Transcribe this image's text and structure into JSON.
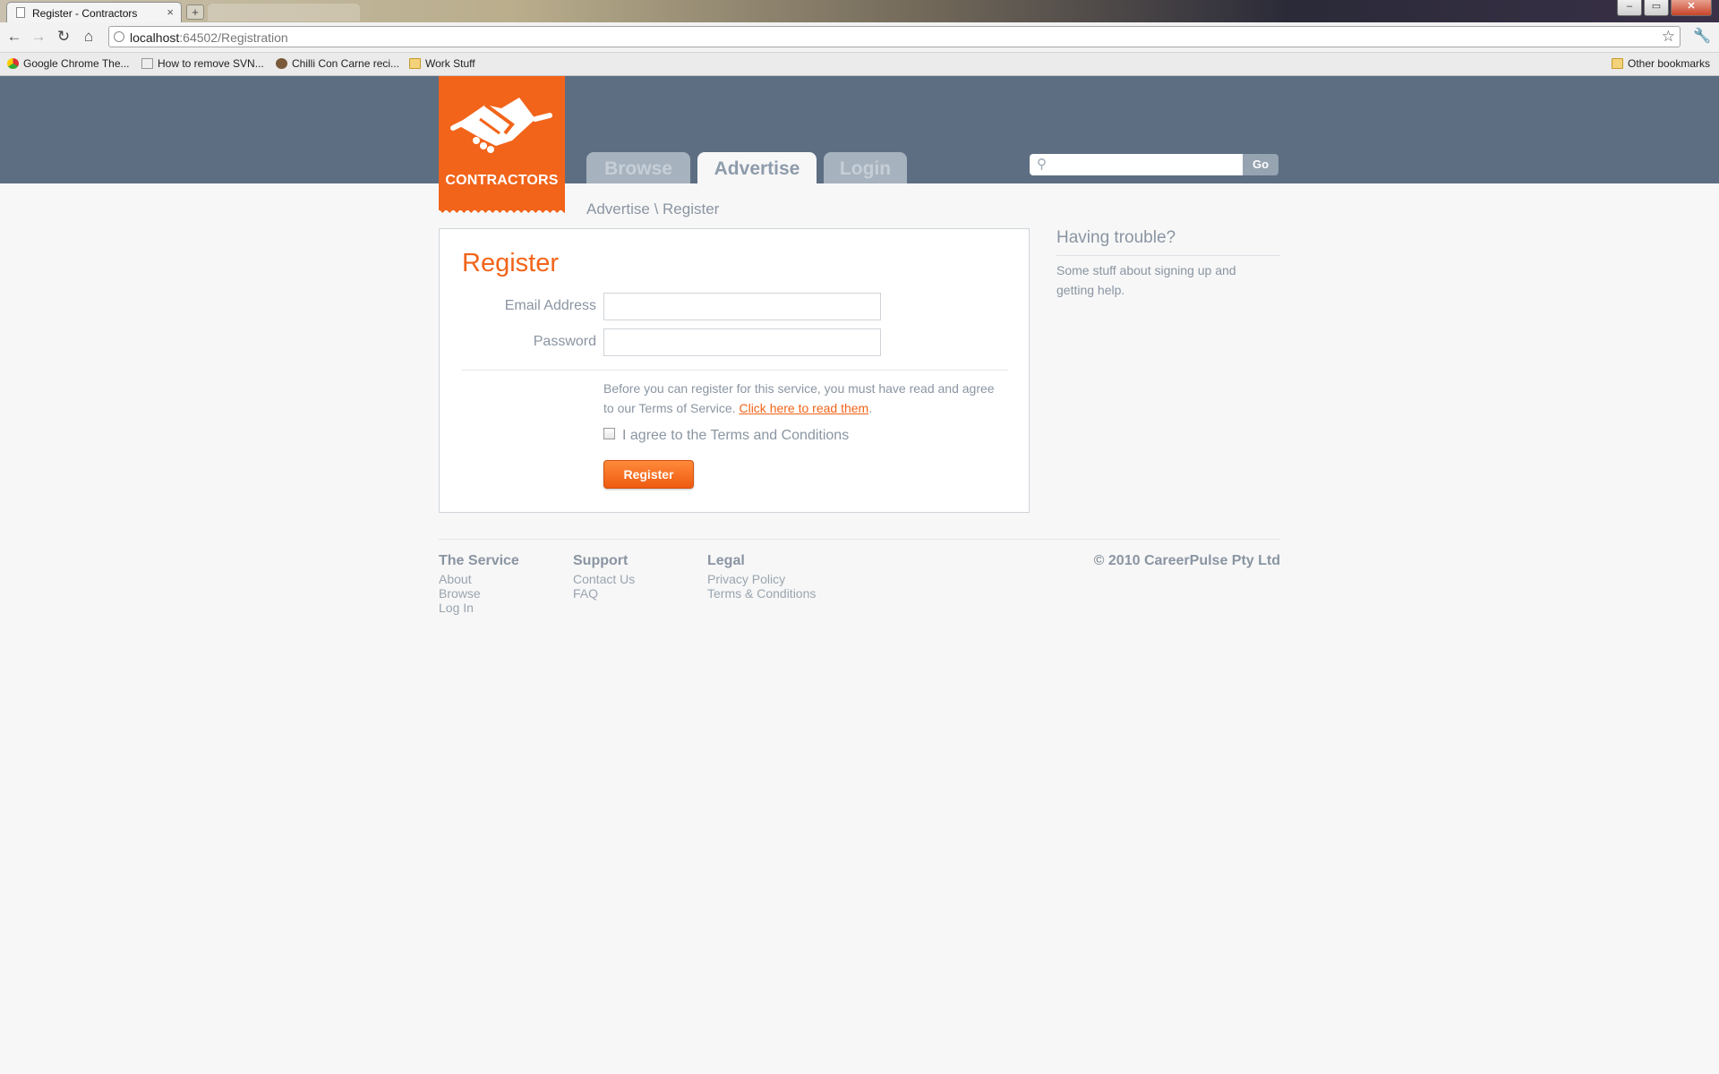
{
  "browser": {
    "tab_title": "Register - Contractors",
    "tab_close": "×",
    "new_tab": "+",
    "url_host": "localhost",
    "url_path": ":64502/Registration",
    "window_buttons": [
      "‒",
      "▭",
      "✕"
    ],
    "bookmarks": [
      {
        "label": "Google Chrome The...",
        "icon": "chrome-icon"
      },
      {
        "label": "How to remove SVN...",
        "icon": "document-icon"
      },
      {
        "label": "Chilli Con Carne reci...",
        "icon": "chilli-icon"
      },
      {
        "label": "Work Stuff",
        "icon": "folder-icon"
      }
    ],
    "other_bookmarks": "Other bookmarks"
  },
  "site": {
    "logo_text": "CONTRACTORS",
    "nav": [
      {
        "label": "Browse",
        "active": false
      },
      {
        "label": "Advertise",
        "active": true
      },
      {
        "label": "Login",
        "active": false
      }
    ],
    "search": {
      "placeholder": "",
      "button": "Go"
    },
    "accent_color": "#f2641a",
    "header_color": "#5d6e82"
  },
  "breadcrumb": "Advertise \\ Register",
  "form": {
    "title": "Register",
    "email_label": "Email Address",
    "email_value": "",
    "password_label": "Password",
    "password_value": "",
    "terms_text": "Before you can register for this service, you must have read and agree to our Terms of Service.",
    "terms_link": "Click here to read them",
    "terms_period": ".",
    "agree_label": "I agree to the Terms and Conditions",
    "agree_checked": false,
    "submit": "Register"
  },
  "sidebar": {
    "title": "Having trouble?",
    "text": "Some stuff about signing up and getting help."
  },
  "footer": {
    "columns": [
      {
        "heading": "The Service",
        "links": [
          "About",
          "Browse",
          "Log In"
        ]
      },
      {
        "heading": "Support",
        "links": [
          "Contact Us",
          "FAQ"
        ]
      },
      {
        "heading": "Legal",
        "links": [
          "Privacy Policy",
          "Terms & Conditions"
        ]
      }
    ],
    "copyright": "© 2010 CareerPulse Pty Ltd"
  }
}
